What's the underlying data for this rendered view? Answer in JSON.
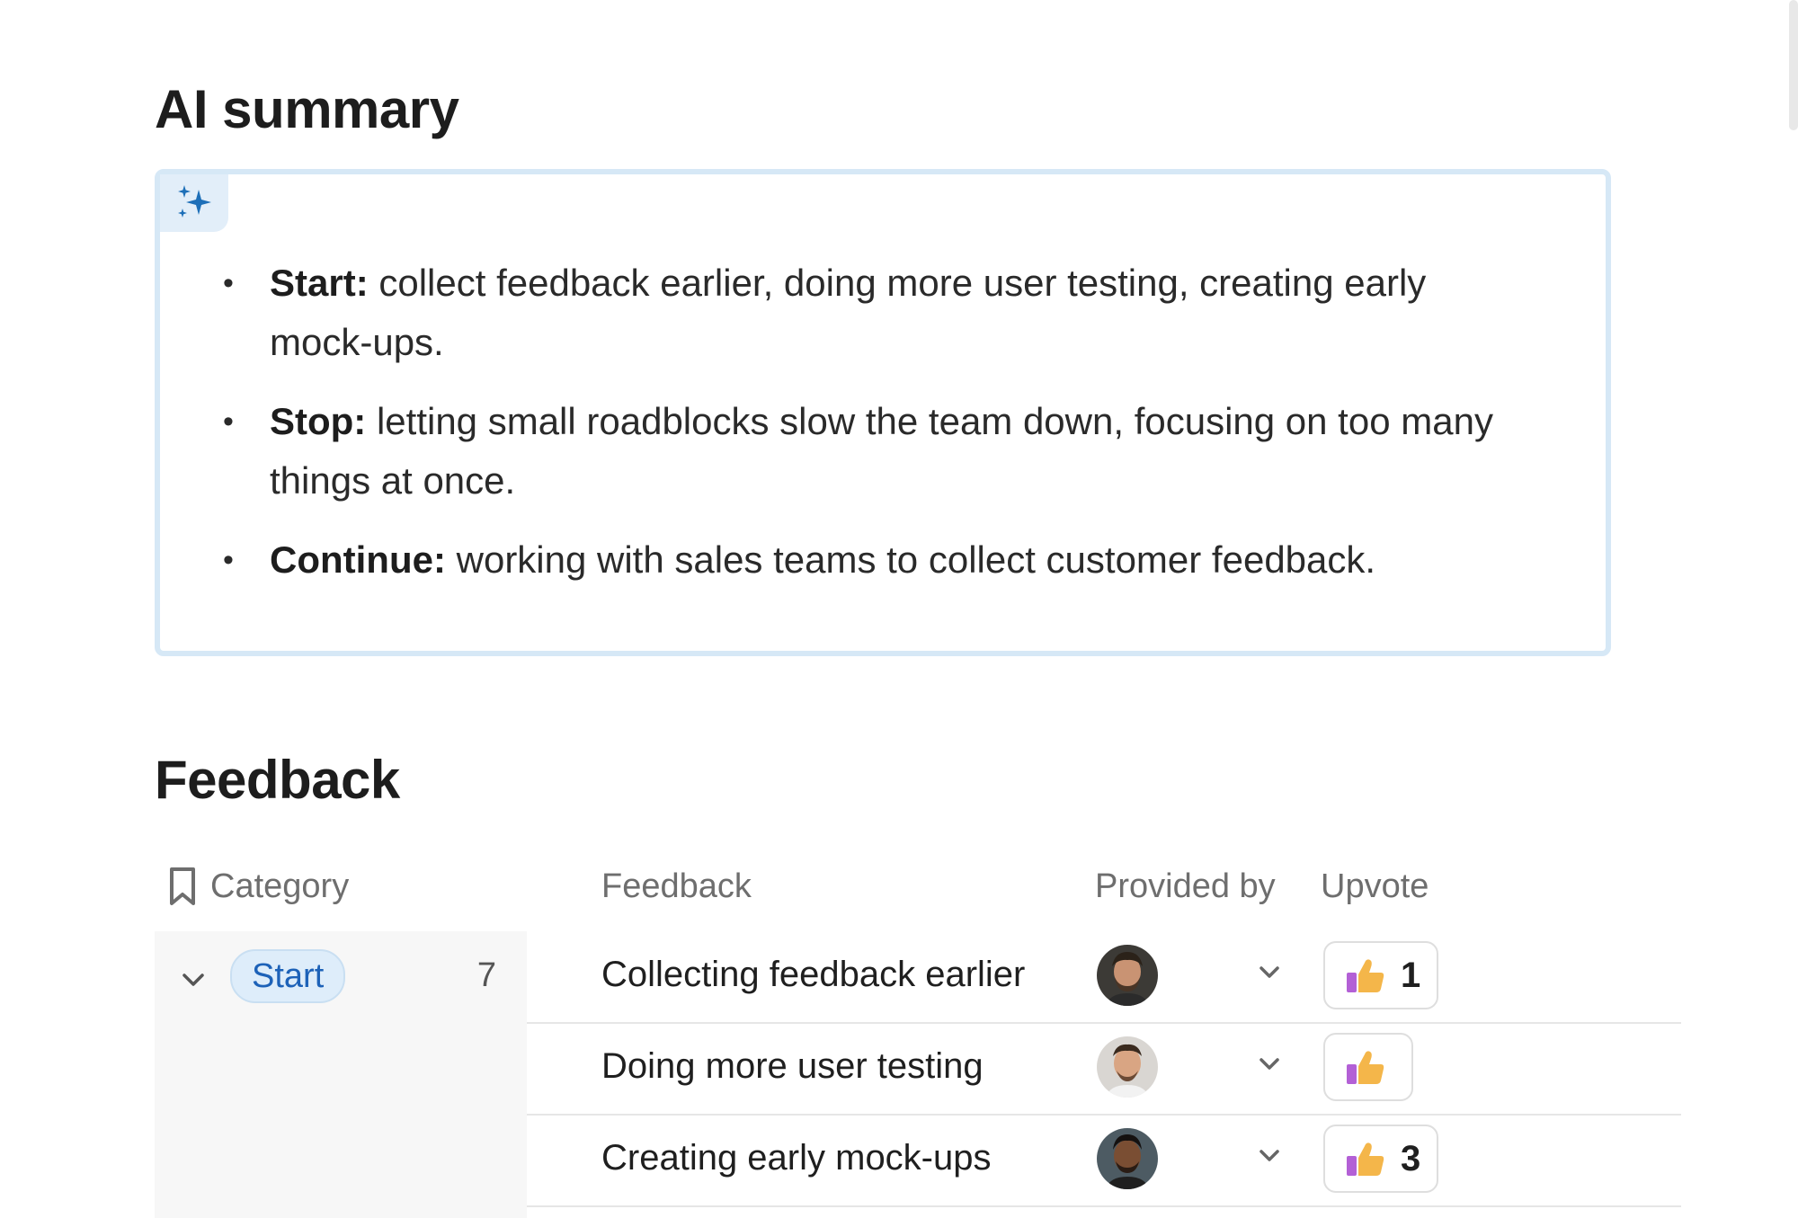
{
  "ai_summary": {
    "title": "AI summary",
    "badge_icon": "sparkles-icon",
    "items": [
      {
        "label": "Start:",
        "text": "collect feedback earlier, doing more user testing, creating early mock-ups."
      },
      {
        "label": "Stop:",
        "text": "letting small roadblocks slow the team down, focusing on too many things at once."
      },
      {
        "label": "Continue:",
        "text": "working with sales teams to collect customer feedback."
      }
    ]
  },
  "feedback": {
    "title": "Feedback",
    "columns": {
      "category": "Category",
      "feedback": "Feedback",
      "provided_by": "Provided by",
      "upvote": "Upvote"
    },
    "group": {
      "label": "Start",
      "count": "7"
    },
    "rows": [
      {
        "text": "Collecting feedback earlier",
        "upvotes": "1"
      },
      {
        "text": "Doing more user testing",
        "upvotes": ""
      },
      {
        "text": "Creating early mock-ups",
        "upvotes": "3"
      }
    ]
  },
  "colors": {
    "accent": "#1d62b8",
    "card_border": "#d6e8f6",
    "pill_bg": "#deedfa"
  }
}
